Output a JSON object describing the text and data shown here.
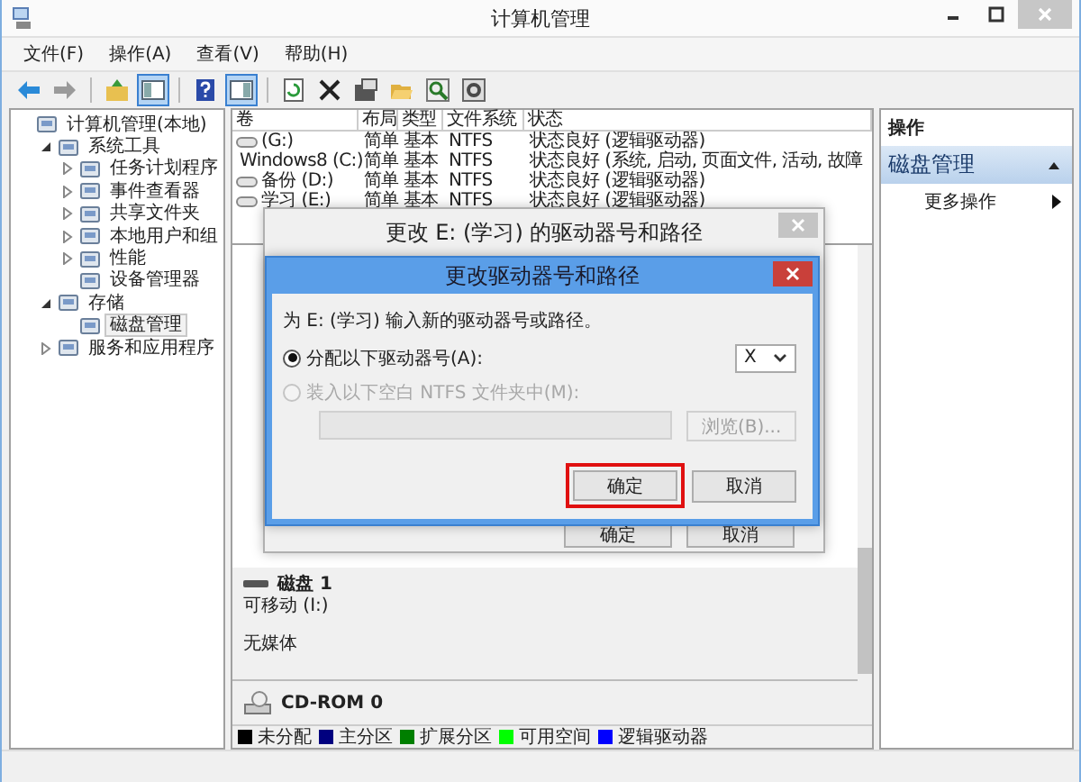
{
  "window": {
    "title": "计算机管理"
  },
  "menu": [
    "文件(F)",
    "操作(A)",
    "查看(V)",
    "帮助(H)"
  ],
  "tree": [
    {
      "label": "计算机管理(本地)",
      "selected": false,
      "children": [
        {
          "label": "系统工具",
          "selected": false,
          "expanded": true,
          "children": [
            {
              "label": "任务计划程序",
              "selected": false,
              "expanded": false
            },
            {
              "label": "事件查看器",
              "selected": false,
              "expanded": false
            },
            {
              "label": "共享文件夹",
              "selected": false,
              "expanded": false
            },
            {
              "label": "本地用户和组",
              "selected": false,
              "expanded": false
            },
            {
              "label": "性能",
              "selected": false,
              "expanded": false
            },
            {
              "label": "设备管理器",
              "selected": false
            }
          ]
        },
        {
          "label": "存储",
          "selected": false,
          "expanded": true,
          "children": [
            {
              "label": "磁盘管理",
              "selected": true
            }
          ]
        },
        {
          "label": "服务和应用程序",
          "selected": false,
          "expanded": false
        }
      ]
    }
  ],
  "table": {
    "columns": [
      "卷",
      "布局",
      "类型",
      "文件系统",
      "状态"
    ],
    "rows": [
      [
        "(G:)",
        "简单",
        "基本",
        "NTFS",
        "状态良好 (逻辑驱动器)"
      ],
      [
        "Windows8 (C:)",
        "简单",
        "基本",
        "NTFS",
        "状态良好 (系统, 启动, 页面文件, 活动, 故障"
      ],
      [
        "备份 (D:)",
        "简单",
        "基本",
        "NTFS",
        "状态良好 (逻辑驱动器)"
      ],
      [
        "学习 (E:)",
        "简单",
        "基本",
        "NTFS",
        "状态良好 (逻辑驱动器)"
      ]
    ]
  },
  "disks": [
    {
      "kind": "removable",
      "name": "磁盘 1",
      "lines": [
        "可移动 (I:)",
        "无媒体"
      ]
    },
    {
      "kind": "cdrom",
      "name": "CD-ROM 0"
    }
  ],
  "legend": [
    {
      "label": "未分配",
      "color": "#000000"
    },
    {
      "label": "主分区",
      "color": "#00007f"
    },
    {
      "label": "扩展分区",
      "color": "#007f00"
    },
    {
      "label": "可用空间",
      "color": "#00ff00"
    },
    {
      "label": "逻辑驱动器",
      "color": "#0000ff"
    }
  ],
  "actions": {
    "header": "操作",
    "sections": [
      {
        "title": "磁盘管理",
        "expanded": true,
        "items": [
          "更多操作"
        ]
      }
    ]
  },
  "back_dialog": {
    "title": "更改 E: (学习) 的驱动器号和路径",
    "buttons": [
      "确定",
      "取消"
    ]
  },
  "dialog": {
    "title": "更改驱动器号和路径",
    "prompt": "为 E: (学习) 输入新的驱动器号或路径。",
    "options": [
      {
        "label": "分配以下驱动器号(A):",
        "selected": true,
        "disabled": false
      },
      {
        "label": "装入以下空白 NTFS 文件夹中(M):",
        "selected": false,
        "disabled": true
      }
    ],
    "drive_letter": "X",
    "folder_field": {
      "disabled": true
    },
    "browse": {
      "label": "浏览(B)...",
      "disabled": true
    },
    "buttons": [
      {
        "label": "确定",
        "highlighted": true
      },
      {
        "label": "取消",
        "highlighted": false
      }
    ]
  }
}
